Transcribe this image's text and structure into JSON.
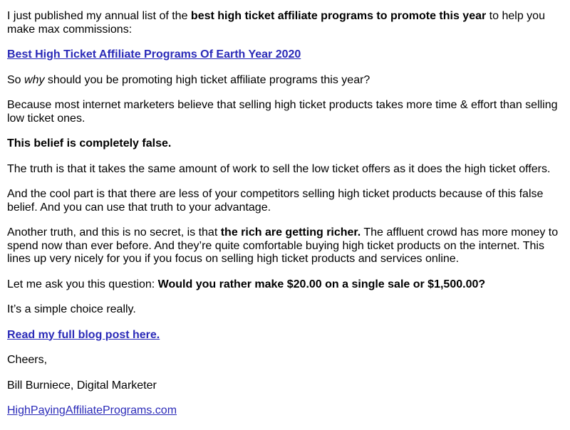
{
  "email": {
    "p1": {
      "before": "I just published my annual list of the ",
      "bold": "best high ticket affiliate programs to promote this year",
      "after": " to help you make max commissions:"
    },
    "link_list": "Best High Ticket Affiliate Programs Of Earth Year 2020",
    "p2": {
      "before": "So ",
      "italic": "why",
      "after": " should you be promoting high ticket affiliate programs this year?"
    },
    "p3": "Because most internet marketers believe that selling high ticket products takes more time & effort than selling low ticket ones.",
    "p4": "This belief is completely false.",
    "p5": "The truth is that it takes the same amount of work to sell the low ticket offers as it does the high ticket offers.",
    "p6": "And the cool part is that there are less of your competitors selling high ticket products because of this false belief. And you can use that truth to your advantage.",
    "p7": {
      "before": "Another truth, and this is no secret, is that ",
      "bold": "the rich are getting richer.",
      "after": " The affluent crowd has more money to spend now than ever before. And they’re quite comfortable buying high ticket products on the internet. This lines up very nicely for you if you focus on selling high ticket products and services online."
    },
    "p8": {
      "before": "Let me ask you this question: ",
      "bold": "Would you rather make $20.00 on a single sale or $1,500.00?"
    },
    "p9": "It’s a simple choice really.",
    "link_blog": "Read my full blog post here.",
    "closing": "Cheers,",
    "signature": "Bill Burniece, Digital Marketer",
    "link_site": "HighPayingAffiliatePrograms.com",
    "colors": {
      "link": "#2a2ab8",
      "text": "#000000",
      "background": "#ffffff"
    }
  }
}
